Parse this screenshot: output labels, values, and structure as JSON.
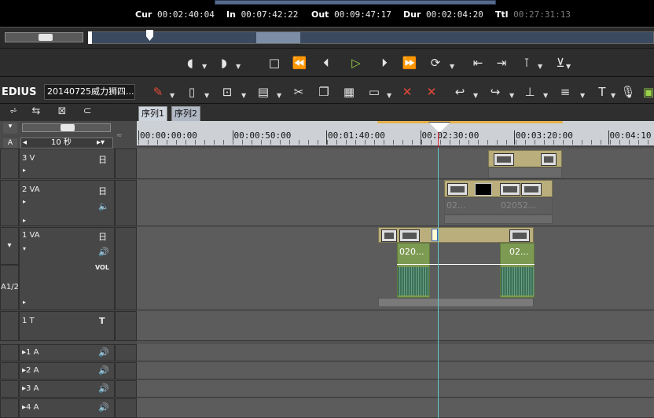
{
  "timecodes": {
    "cur_label": "Cur",
    "cur_value": "00:02:40:04",
    "in_label": "In",
    "in_value": "00:07:42:22",
    "out_label": "Out",
    "out_value": "00:09:47:17",
    "dur_label": "Dur",
    "dur_value": "00:02:04:20",
    "ttl_label": "Ttl",
    "ttl_value": "00:27:31:13"
  },
  "app": {
    "logo": "EDIUS",
    "project_name": "20140725威力狮四..."
  },
  "sequence_tabs": [
    {
      "label": "序列1"
    },
    {
      "label": "序列2"
    }
  ],
  "zoom": {
    "value": "10 秒"
  },
  "ruler": {
    "labels": [
      "00:00:00:00",
      "00:00:50:00",
      "00:01:40:00",
      "00:02:30:00",
      "00:03:20:00",
      "00:04:10"
    ]
  },
  "tracks": {
    "v3": {
      "name": "3 V"
    },
    "va2": {
      "name": "2 VA",
      "clip1": "02...",
      "clip2": "02052..."
    },
    "va1": {
      "name": "1 VA",
      "vol": "VOL",
      "clip1": "020...",
      "clip2": "02..."
    },
    "t1": {
      "name": "1 T",
      "icon": "T"
    },
    "a1": {
      "name": "1 A"
    },
    "a2": {
      "name": "2 A"
    },
    "a3": {
      "name": "3 A"
    },
    "a4": {
      "name": "4 A"
    },
    "side_label": "A1/2"
  },
  "colors": {
    "playhead": "#5ec9cc",
    "inout": "#e7b24a",
    "play": "#9ad34a",
    "clip": "#b9ae7c",
    "audio": "#7d9a52"
  }
}
